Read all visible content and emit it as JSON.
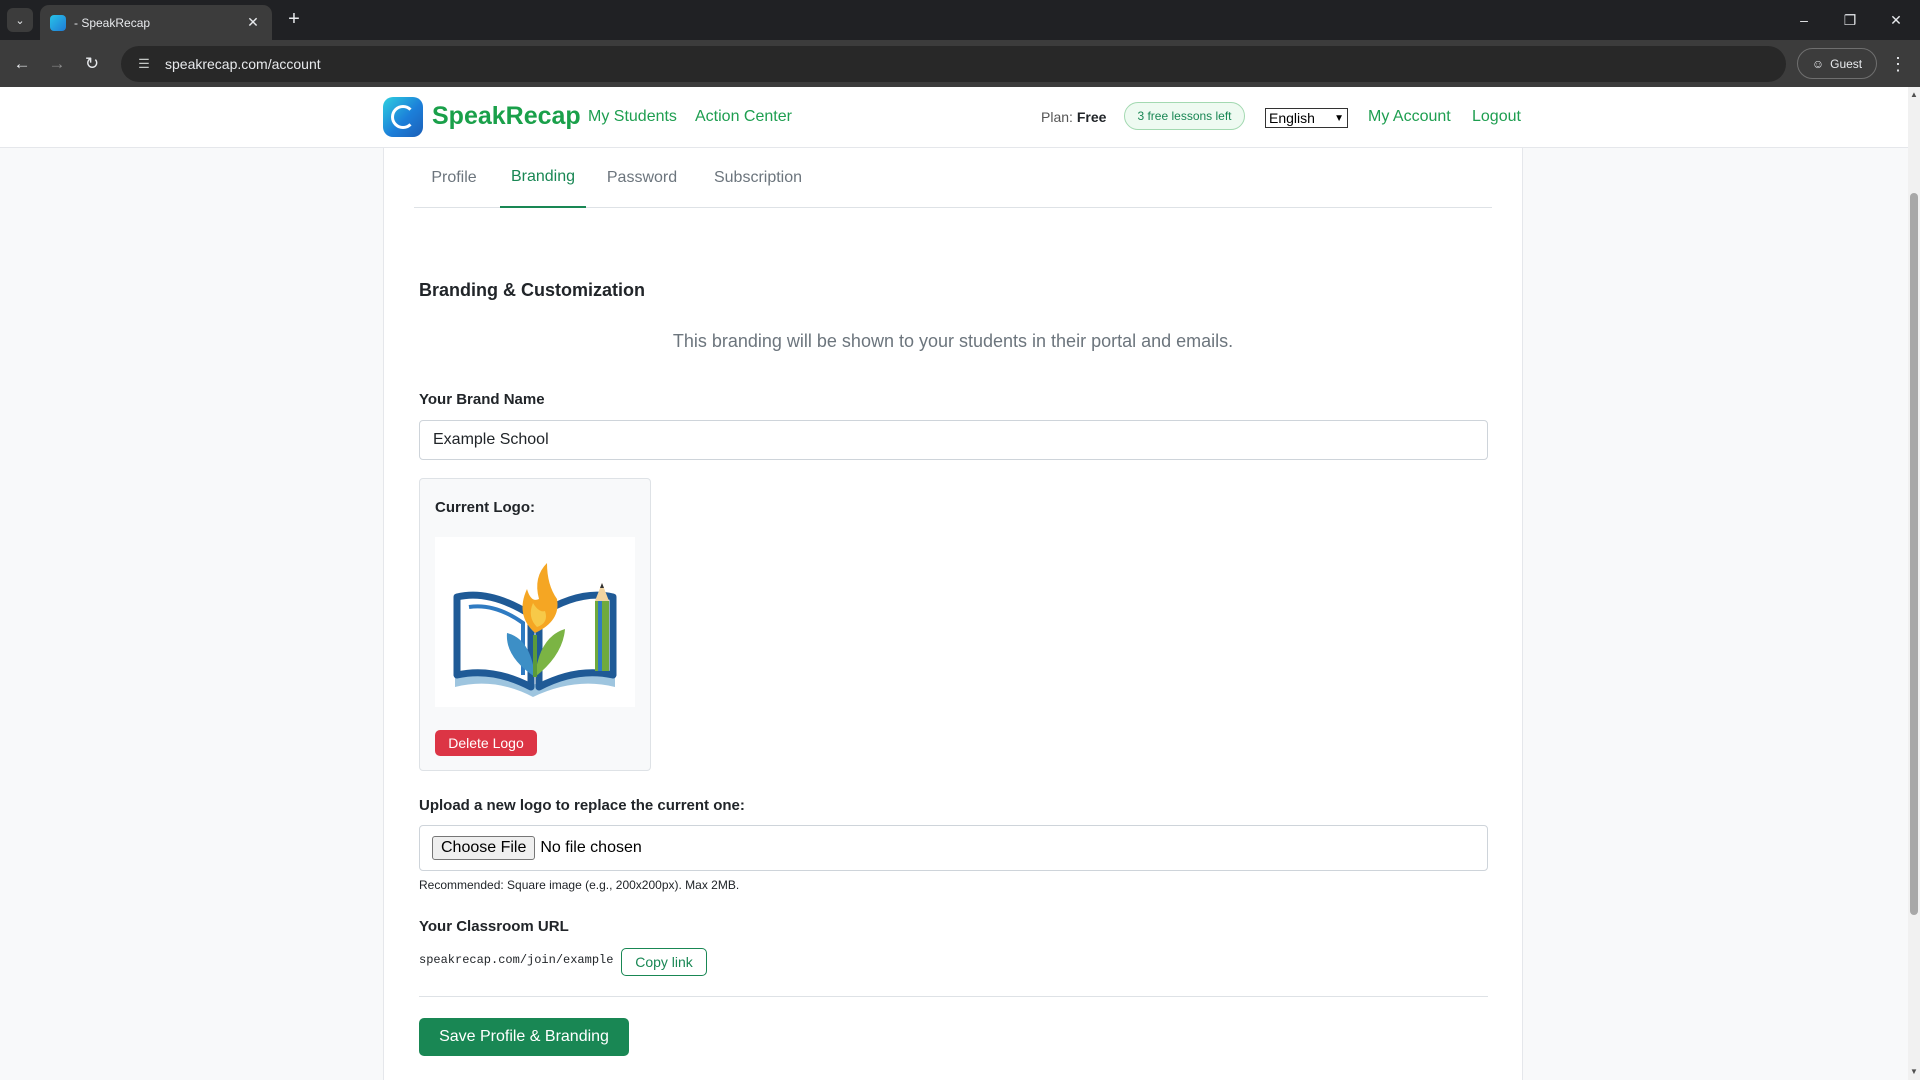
{
  "browser": {
    "tab_title": "- SpeakRecap",
    "url": "speakrecap.com/account",
    "profile_label": "Guest"
  },
  "header": {
    "brand_name": "SpeakRecap",
    "nav": [
      "My Students",
      "Action Center"
    ],
    "plan_label": "Plan:",
    "plan_value": "Free",
    "lessons_badge": "3 free lessons left",
    "language": "English",
    "my_account": "My Account",
    "logout": "Logout"
  },
  "tabs": [
    "Profile",
    "Branding",
    "Password",
    "Subscription"
  ],
  "active_tab": "Branding",
  "branding": {
    "title": "Branding & Customization",
    "subtitle": "This branding will be shown to your students in their portal and emails.",
    "brand_name_label": "Your Brand Name",
    "brand_name_value": "Example School",
    "current_logo_label": "Current Logo:",
    "delete_logo": "Delete Logo",
    "upload_label": "Upload a new logo to replace the current one:",
    "choose_file": "Choose File",
    "no_file": "No file chosen",
    "recommendation": "Recommended: Square image (e.g., 200x200px). Max 2MB.",
    "classroom_url_label": "Your Classroom URL",
    "classroom_url": "speakrecap.com/join/example",
    "copy_link": "Copy link",
    "save_button": "Save Profile & Branding"
  },
  "colors": {
    "brand_green": "#1aa04a",
    "primary_green": "#198754",
    "danger": "#dc3545"
  }
}
